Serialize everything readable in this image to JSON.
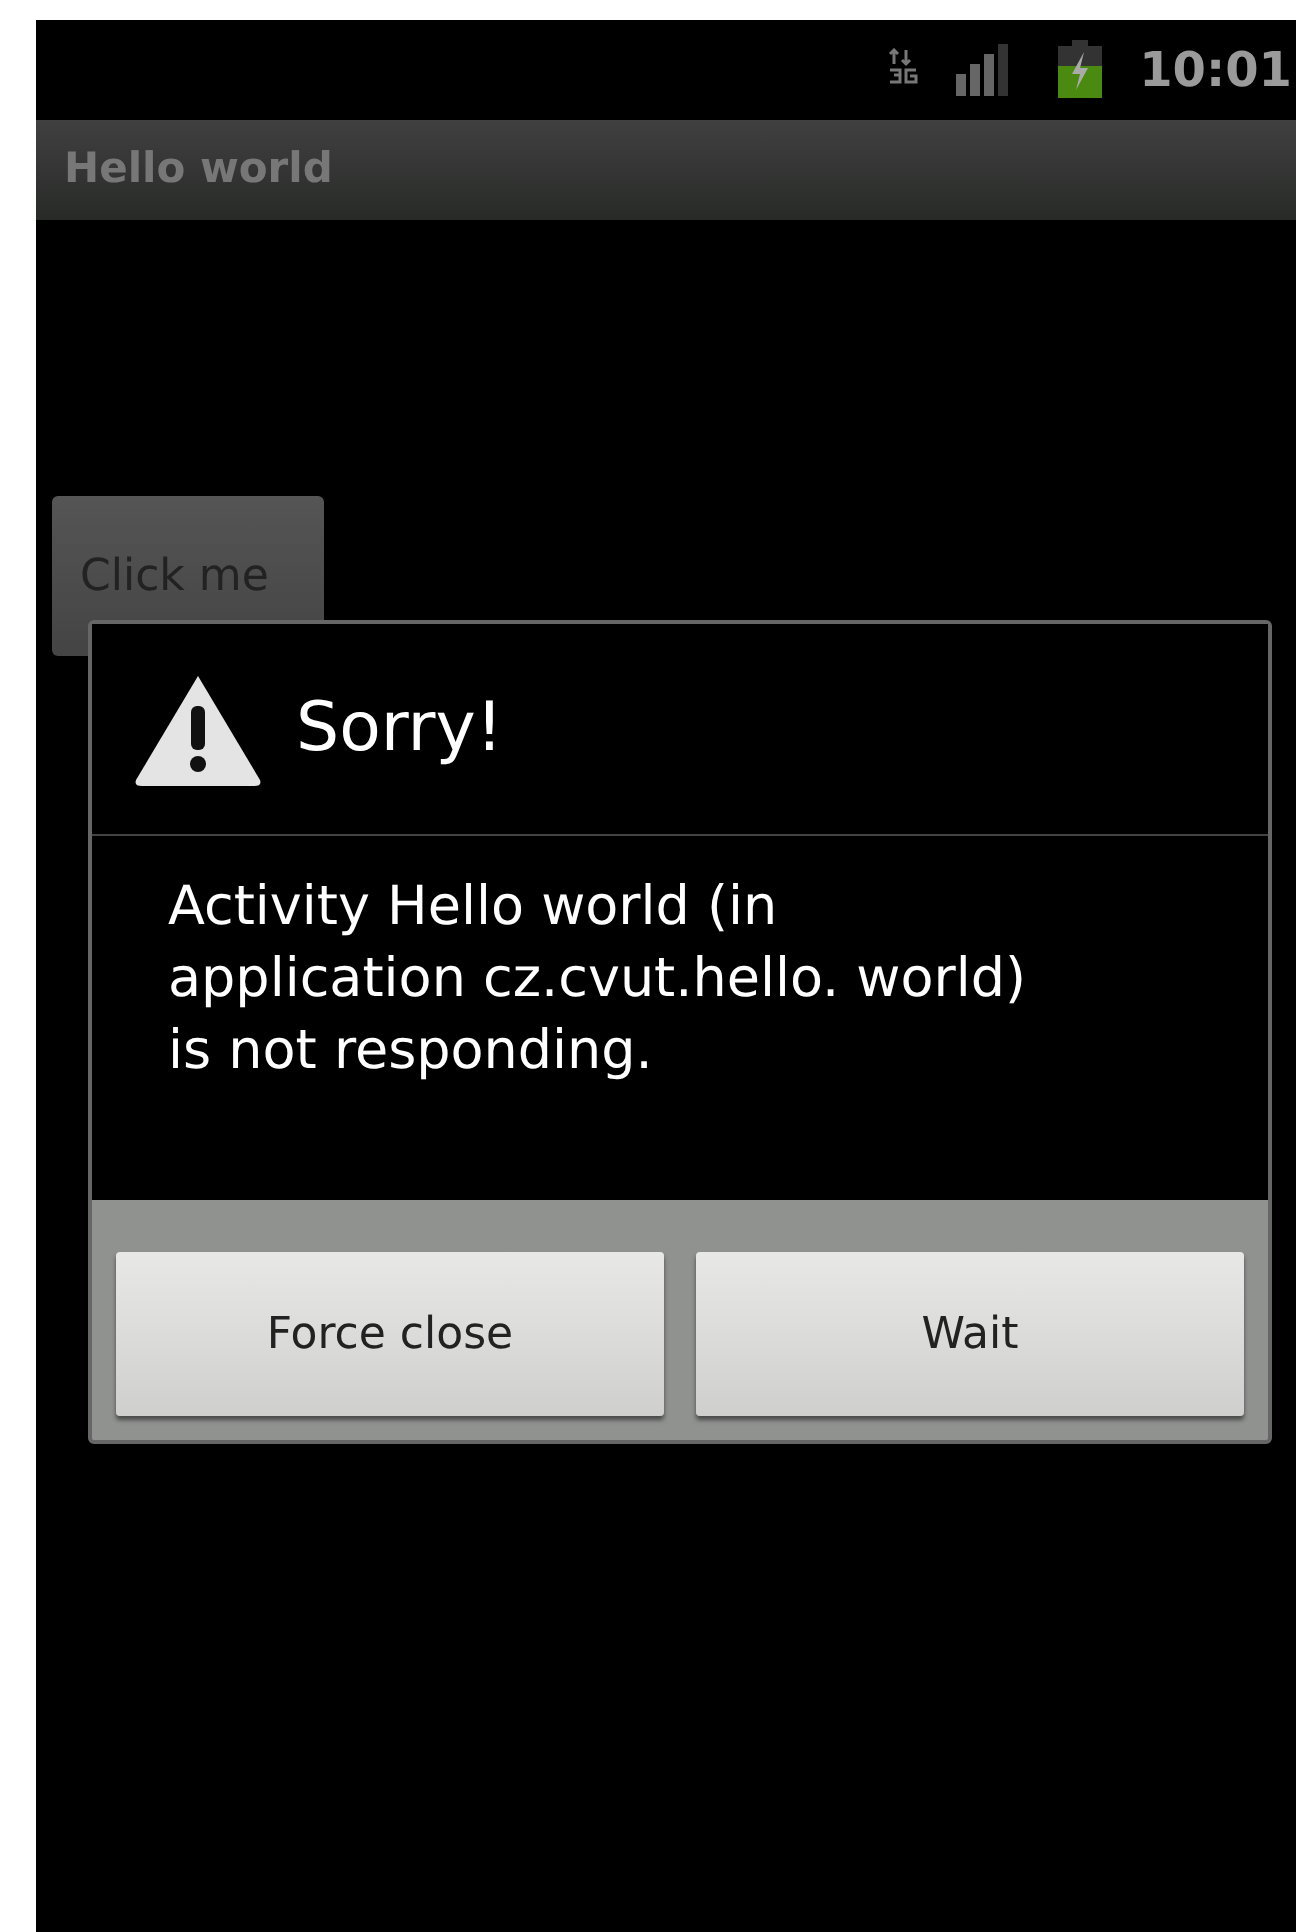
{
  "status_bar": {
    "time": "10:01"
  },
  "app_bar": {
    "title": "Hello world"
  },
  "content": {
    "button": "Click me"
  },
  "dialog": {
    "title": "Sorry!",
    "message": "Activity Hello world (in application cz.cvut.hello. world) is not responding.",
    "buttons": [
      "Force close",
      "Wait"
    ]
  }
}
